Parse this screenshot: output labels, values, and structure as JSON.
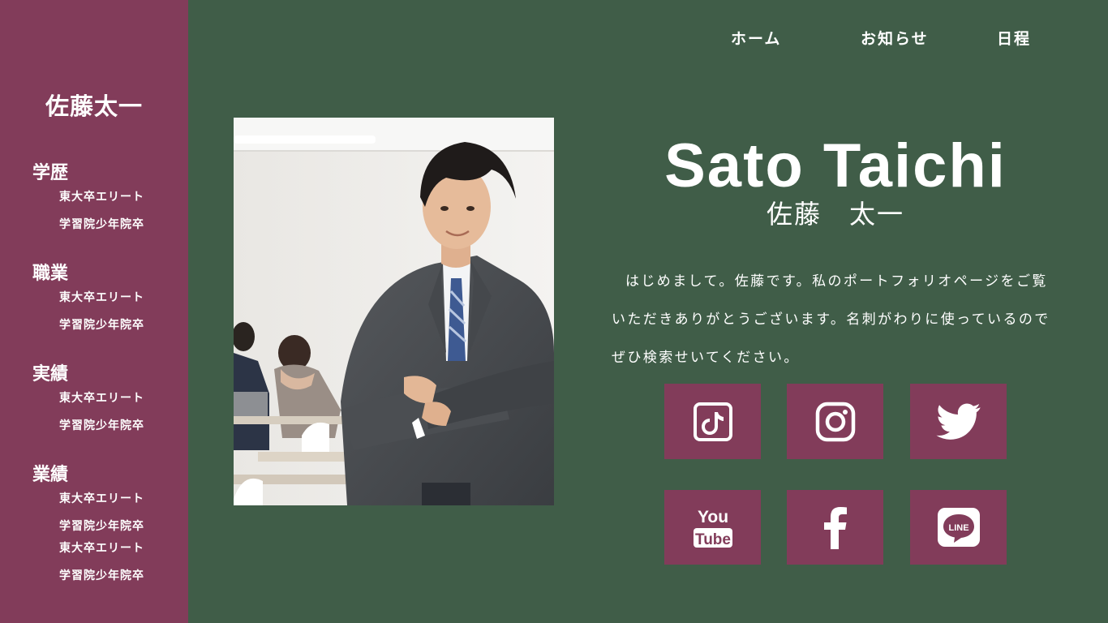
{
  "nav": {
    "items": [
      {
        "label": "ホーム"
      },
      {
        "label": "お知らせ"
      },
      {
        "label": "日程"
      }
    ]
  },
  "sidebar": {
    "name": "佐藤太一",
    "sections": [
      {
        "heading": "学歴",
        "items": [
          "東大卒エリート",
          "学習院少年院卒"
        ]
      },
      {
        "heading": "職業",
        "items": [
          "東大卒エリート",
          "学習院少年院卒"
        ]
      },
      {
        "heading": "実績",
        "items": [
          "東大卒エリート",
          "学習院少年院卒"
        ]
      },
      {
        "heading": "業績",
        "items": [
          "東大卒エリート",
          "学習院少年院卒",
          "東大卒エリート",
          "学習院少年院卒"
        ]
      }
    ]
  },
  "profile": {
    "name_en": "Sato Taichi",
    "name_jp": "佐藤　太一",
    "intro": "はじめまして。佐藤です。私のポートフォリオページをご覧いただきありがとうございます。名刺がわりに使っているのでぜひ検索せいてください。"
  },
  "social": {
    "icons": [
      "tiktok-icon",
      "instagram-icon",
      "twitter-icon",
      "youtube-icon",
      "facebook-icon",
      "line-icon"
    ],
    "youtube_text_top": "You",
    "youtube_text_bottom": "Tube",
    "line_text": "LINE"
  },
  "colors": {
    "background": "#405d48",
    "accent": "#823c5a",
    "text": "#ffffff"
  }
}
